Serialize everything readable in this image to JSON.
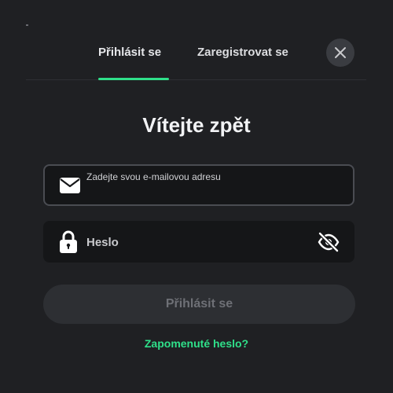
{
  "tabs": {
    "login_label": "Přihlásit se",
    "register_label": "Zaregistrovat se",
    "active": "login"
  },
  "header": {
    "title": "Vítejte zpět"
  },
  "form": {
    "email_placeholder": "Zadejte svou e-mailovou adresu",
    "email_value": "",
    "password_placeholder": "Heslo",
    "password_value": "",
    "submit_label": "Přihlásit se",
    "forgot_label": "Zapomenuté heslo?"
  },
  "icons": {
    "close": "close-icon",
    "email": "envelope-icon",
    "password": "lock-icon",
    "visibility": "eye-slash-icon"
  },
  "colors": {
    "accent": "#2fe08a",
    "background": "#1f2023",
    "field_background": "#151618",
    "button_disabled": "#2d2f33"
  }
}
